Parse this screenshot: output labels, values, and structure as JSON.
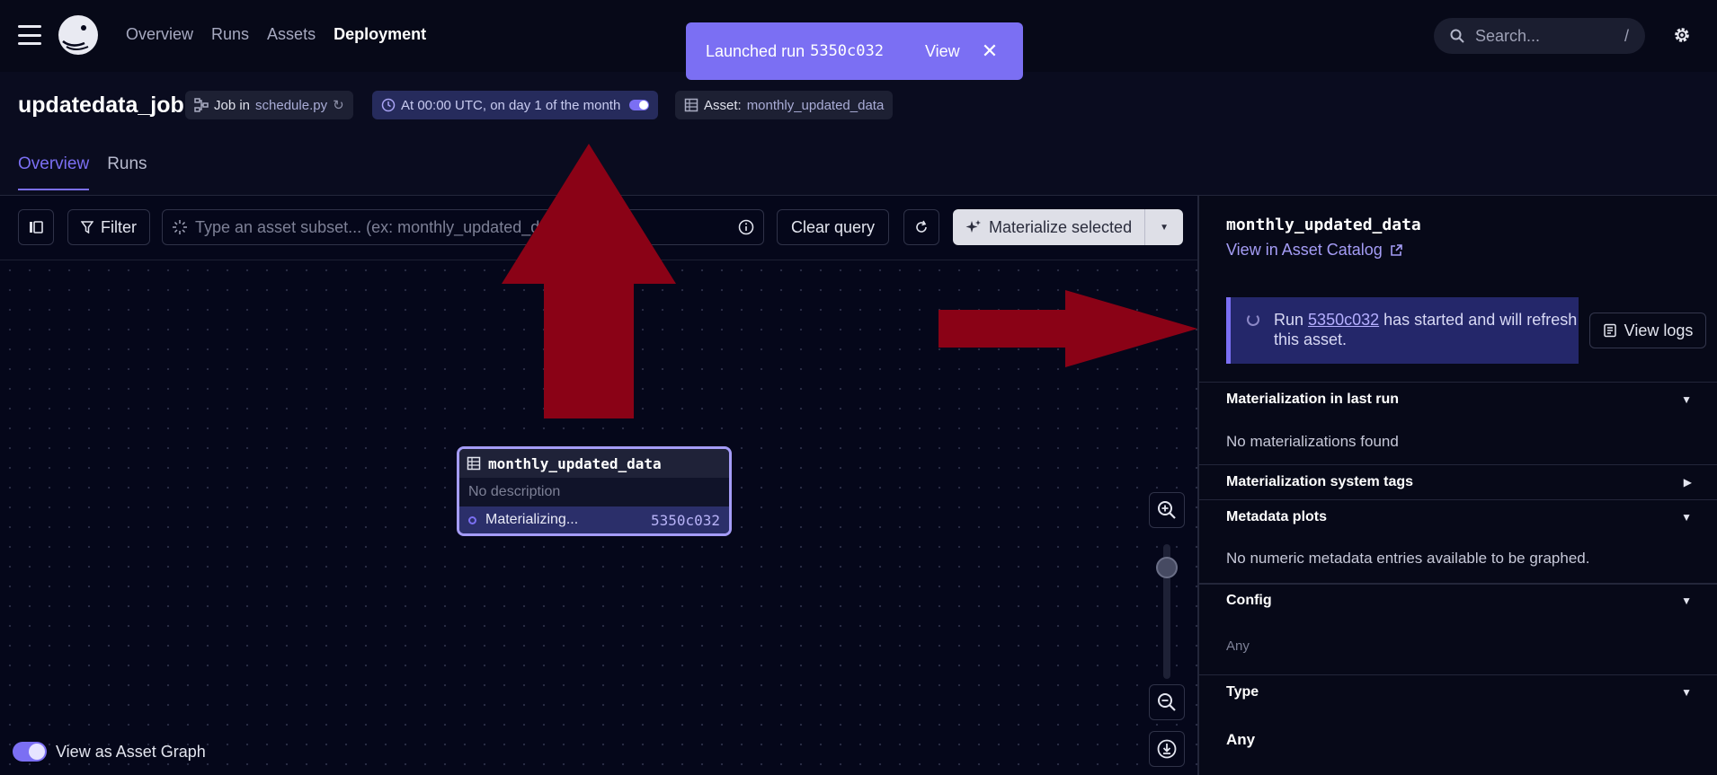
{
  "nav": {
    "links": [
      "Overview",
      "Runs",
      "Assets",
      "Deployment"
    ],
    "search_placeholder": "Search...",
    "search_shortcut": "/"
  },
  "toast": {
    "text": "Launched run",
    "run_id": "5350c032",
    "view_label": "View",
    "close_glyph": "✕"
  },
  "job": {
    "title": "updatedata_job",
    "job_tag_prefix": "Job in",
    "job_tag_file": "schedule.py",
    "schedule": "At 00:00 UTC, on day 1 of the month",
    "asset_tag_prefix": "Asset:",
    "asset_tag_name": "monthly_updated_data"
  },
  "tabs": [
    "Overview",
    "Runs"
  ],
  "toolbar": {
    "filter_label": "Filter",
    "query_placeholder": "Type an asset subset... (ex: monthly_updated_data)",
    "clear_label": "Clear query",
    "materialize_label": "Materialize selected"
  },
  "node": {
    "name": "monthly_updated_data",
    "description": "No description",
    "status": "Materializing...",
    "run_id": "5350c032"
  },
  "graph_toggle_label": "View as Asset Graph",
  "panel": {
    "title": "monthly_updated_data",
    "catalog_link": "View in Asset Catalog",
    "banner_pre": "Run",
    "banner_run_id": "5350c032",
    "banner_post": "has started and will refresh this asset.",
    "view_logs": "View logs",
    "sections": {
      "mat_last_run": "Materialization in last run",
      "mat_last_run_body": "No materializations found",
      "mat_tags": "Materialization system tags",
      "metadata_plots": "Metadata plots",
      "metadata_plots_body": "No numeric metadata entries available to be graphed.",
      "config": "Config",
      "config_body": "Any",
      "type": "Type",
      "type_body": "Any"
    }
  },
  "colors": {
    "accent": "#7b6ff3",
    "background": "#05071a",
    "arrow": "#8a0216"
  }
}
